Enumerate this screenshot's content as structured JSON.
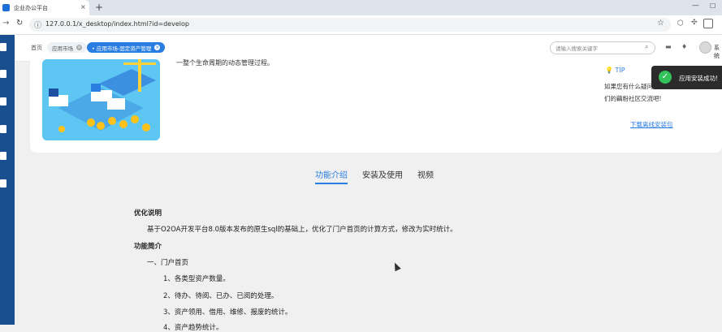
{
  "browser": {
    "tab_title": "企业办公平台",
    "tab_close": "×",
    "new_tab": "+",
    "minimize": "—",
    "restore": "☐",
    "url": "127.0.0.1/x_desktop/index.html?id=develop"
  },
  "header": {
    "breadcrumb_home": "首页",
    "breadcrumb_market": "应用市场",
    "breadcrumb_current": "• 应用市场-固定资产管理",
    "search_placeholder": "请输入搜索关键字",
    "user_name": "系统"
  },
  "card": {
    "description": "一整个生命周期的动态管理过程。",
    "tip_title": "TIP",
    "tip_line1": "如果您有什么疑问",
    "tip_line2": "们的藕粉社区交流吧!",
    "download_link": "下载离线安装包"
  },
  "toast": {
    "message": "应用安装成功!"
  },
  "tabs": [
    {
      "label": "功能介绍"
    },
    {
      "label": "安装及使用"
    },
    {
      "label": "视频"
    }
  ],
  "content": {
    "heading1": "优化说明",
    "para1": "基于O2OA开发平台8.0版本发布的原生sql的基础上，优化了门户首页的计算方式，修改为实时统计。",
    "heading2": "功能简介",
    "item_portal": "一、门户首页",
    "sub1": "1、各类型资产数量。",
    "sub2": "2、待办、待阅、已办、已阅的处理。",
    "sub3": "3、资产领用、借用、维修、报废的统计。",
    "sub4": "4、资产趋势统计。"
  },
  "colors": {
    "accent": "#2a7de1",
    "sidebar": "#1a4f8f",
    "toast_bg": "#2b2b2b",
    "success": "#33c25a"
  }
}
